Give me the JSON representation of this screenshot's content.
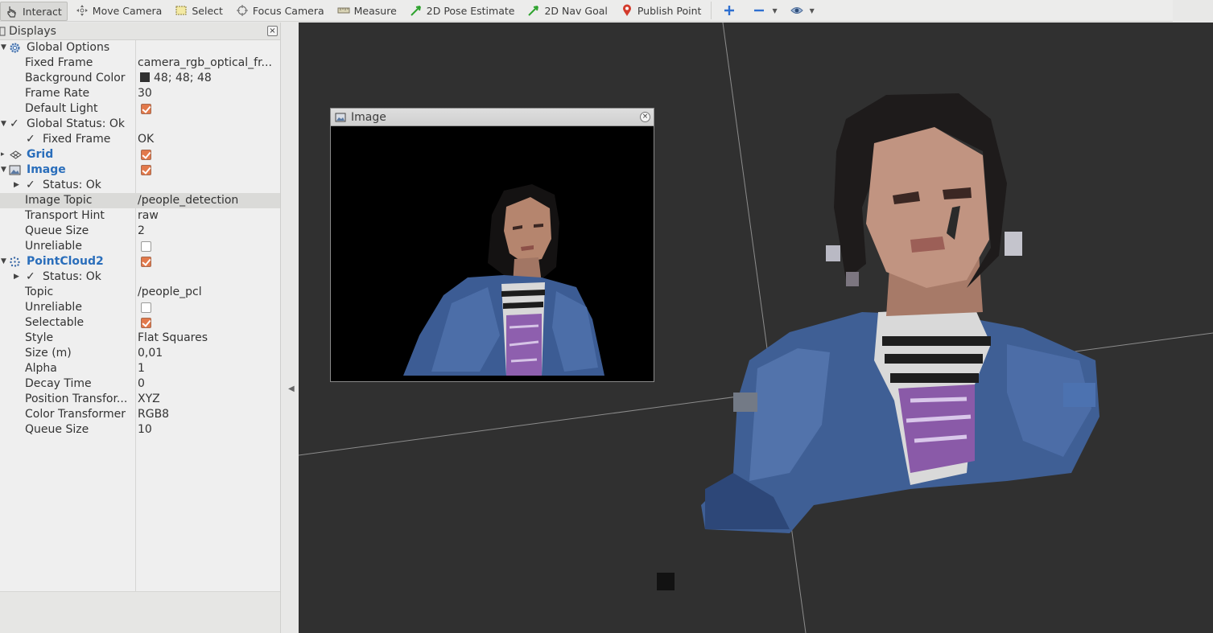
{
  "toolbar": {
    "interact": "Interact",
    "move_camera": "Move Camera",
    "select": "Select",
    "focus_camera": "Focus Camera",
    "measure": "Measure",
    "pose_estimate": "2D Pose Estimate",
    "nav_goal": "2D Nav Goal",
    "publish_point": "Publish Point"
  },
  "displays": {
    "title": "Displays",
    "close": "×",
    "rows": {
      "global_options": "Global Options",
      "fixed_frame": {
        "label": "Fixed Frame",
        "value": "camera_rgb_optical_fr..."
      },
      "background_color": {
        "label": "Background Color",
        "value": "48; 48; 48"
      },
      "frame_rate": {
        "label": "Frame Rate",
        "value": "30"
      },
      "default_light": {
        "label": "Default Light"
      },
      "global_status": "Global Status: Ok",
      "fixed_frame_status": {
        "label": "Fixed Frame",
        "value": "OK"
      },
      "grid": "Grid",
      "image": "Image",
      "image_status": "Status: Ok",
      "image_topic": {
        "label": "Image Topic",
        "value": "/people_detection"
      },
      "transport_hint": {
        "label": "Transport Hint",
        "value": "raw"
      },
      "image_queue": {
        "label": "Queue Size",
        "value": "2"
      },
      "image_unreliable": {
        "label": "Unreliable"
      },
      "pointcloud": "PointCloud2",
      "pc_status": "Status: Ok",
      "topic": {
        "label": "Topic",
        "value": "/people_pcl"
      },
      "pc_unreliable": {
        "label": "Unreliable"
      },
      "selectable": {
        "label": "Selectable"
      },
      "style": {
        "label": "Style",
        "value": "Flat Squares"
      },
      "size": {
        "label": "Size (m)",
        "value": "0,01"
      },
      "alpha": {
        "label": "Alpha",
        "value": "1"
      },
      "decay": {
        "label": "Decay Time",
        "value": "0"
      },
      "position_transformer": {
        "label": "Position Transfor...",
        "value": "XYZ"
      },
      "color_transformer": {
        "label": "Color Transformer",
        "value": "RGB8"
      },
      "pc_queue": {
        "label": "Queue Size",
        "value": "10"
      }
    }
  },
  "checks": {
    "default_light": true,
    "grid": true,
    "image": true,
    "image_unreliable": false,
    "pointcloud": true,
    "pc_unreliable": false,
    "selectable": true
  },
  "image_window": {
    "title": "Image",
    "close": "×"
  },
  "colors": {
    "viewport_bg": "#303030",
    "group_label": "#2a6ebb",
    "checkbox_on": "#e2794b",
    "ok_check": "#1c7a1c"
  }
}
